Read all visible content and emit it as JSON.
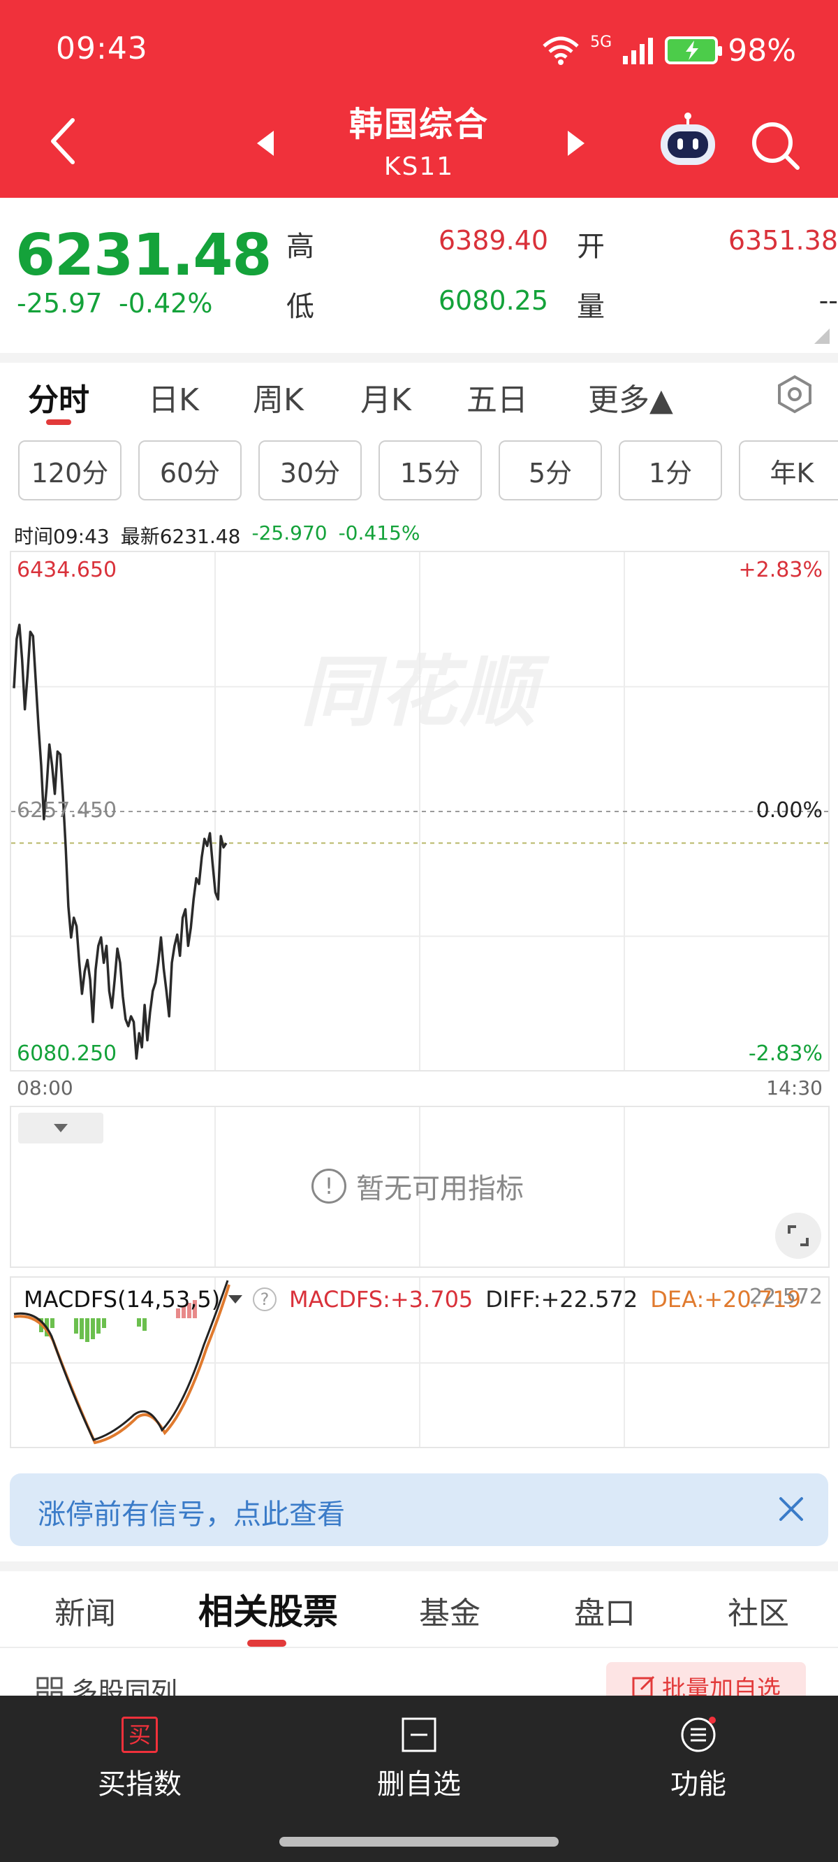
{
  "status": {
    "time": "09:43",
    "battery": "98%",
    "net": "5G"
  },
  "header": {
    "title": "韩国综合",
    "code": "KS11"
  },
  "quote": {
    "price": "6231.48",
    "change": "-25.97",
    "change_pct": "-0.42%",
    "high_label": "高",
    "high": "6389.40",
    "open_label": "开",
    "open": "6351.38",
    "low_label": "低",
    "low": "6080.25",
    "volume_label": "量",
    "volume": "--"
  },
  "period_tabs": [
    "分时",
    "日K",
    "周K",
    "月K",
    "五日",
    "更多▲"
  ],
  "sub_tabs": [
    "120分",
    "60分",
    "30分",
    "15分",
    "5分",
    "1分",
    "年K"
  ],
  "chart_info": {
    "time": "时间09:43",
    "latest": "最新6231.48",
    "change": "-25.970",
    "change_pct": "-0.415%"
  },
  "chart_data": {
    "type": "line",
    "x_start": "08:00",
    "x_end": "14:30",
    "ylim": [
      6080.25,
      6434.65
    ],
    "y_top_label": "6434.650",
    "y_mid_label": "6257.450",
    "y_bottom_label": "6080.250",
    "pct_top": "+2.83%",
    "pct_mid": "0.00%",
    "pct_bottom": "-2.83%",
    "series": [
      {
        "values": [
          6345,
          6380,
          6390,
          6365,
          6330,
          6355,
          6385,
          6382,
          6350,
          6318,
          6290,
          6252,
          6275,
          6305,
          6290,
          6270,
          6300,
          6298,
          6268,
          6232,
          6190,
          6168,
          6182,
          6176,
          6150,
          6128,
          6144,
          6152,
          6138,
          6108,
          6145,
          6162,
          6168,
          6150,
          6162,
          6130,
          6118,
          6138,
          6160,
          6150,
          6126,
          6110,
          6105,
          6112,
          6108,
          6082,
          6100,
          6090,
          6120,
          6095,
          6115,
          6130,
          6136,
          6150,
          6168,
          6146,
          6130,
          6112,
          6150,
          6162,
          6170,
          6155,
          6182,
          6188,
          6162,
          6175,
          6195,
          6210,
          6206,
          6225,
          6238,
          6233,
          6242,
          6220,
          6200,
          6195,
          6240,
          6232,
          6235
        ]
      }
    ]
  },
  "indicator": {
    "empty_text": "暂无可用指标"
  },
  "macd": {
    "label": "MACDFS(14,53,5)",
    "macdfs": "MACDFS:+3.705",
    "diff": "DIFF:+22.572",
    "dea": "DEA:+20.719",
    "right_value": "22.572"
  },
  "banner": {
    "text": "涨停前有信号，点此查看"
  },
  "bottom_tabs": [
    "新闻",
    "相关股票",
    "基金",
    "盘口",
    "社区"
  ],
  "multi_list": {
    "label": "多股同列",
    "batch_button": "批量加自选"
  },
  "bottom_bar": {
    "buy": "买指数",
    "buy_icon": "买",
    "delete": "删自选",
    "function": "功能"
  },
  "colors": {
    "header_red": "#f0313b",
    "up_red": "#d9313a",
    "down_green": "#14a23a",
    "accent": "#e23a3a"
  }
}
